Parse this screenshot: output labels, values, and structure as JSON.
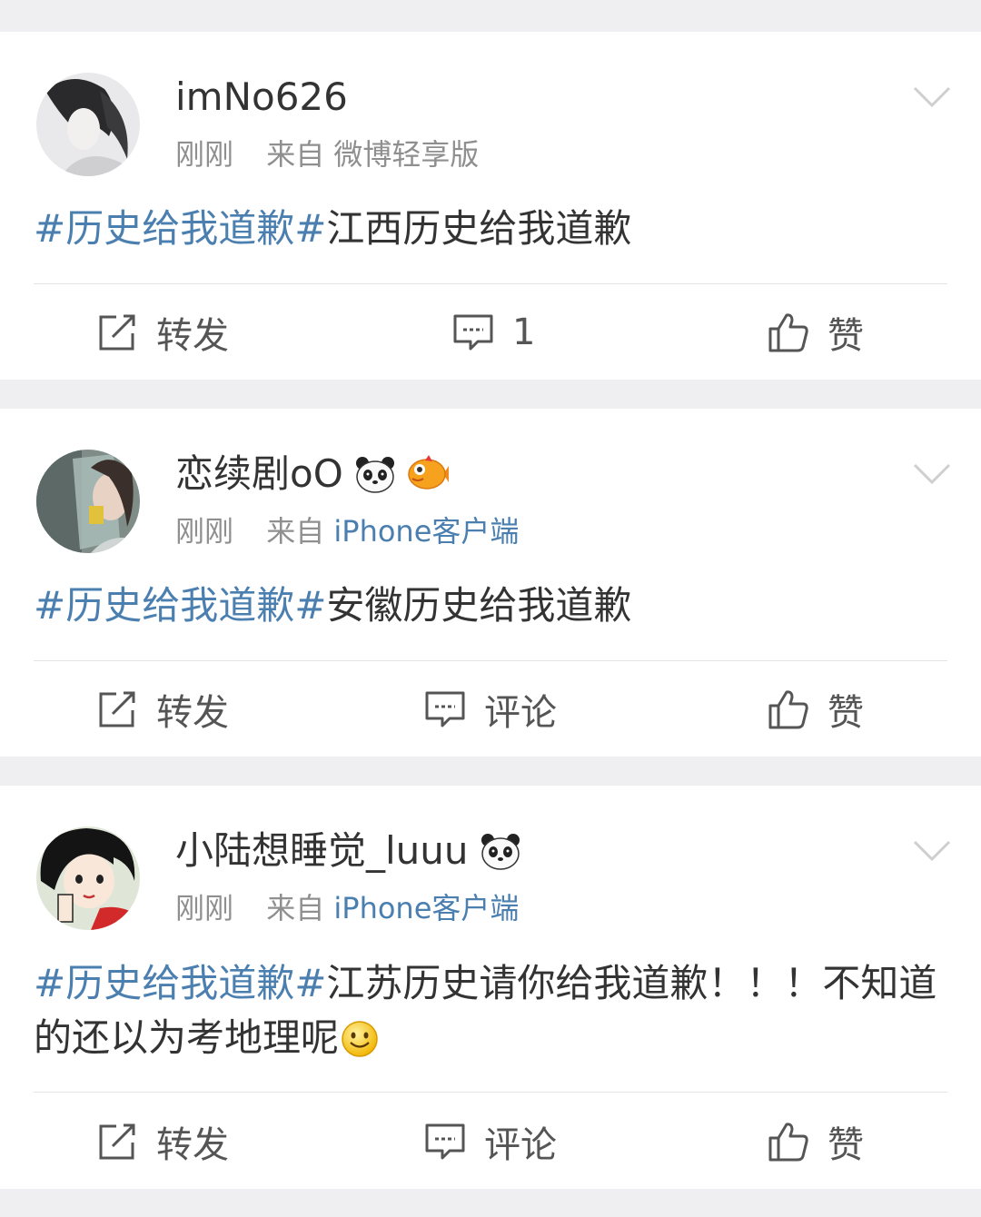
{
  "posts": [
    {
      "username": "imNo626",
      "time": "刚刚",
      "source_prefix": "来自",
      "source": "微博轻享版",
      "hashtag": "#历史给我道歉#",
      "text": "江西历史给我道歉",
      "actions": {
        "repost": "转发",
        "comment": "1",
        "like": "赞"
      },
      "badges": []
    },
    {
      "username": "恋续剧oO",
      "time": "刚刚",
      "source_prefix": "来自",
      "source": "iPhone客户端",
      "hashtag": "#历史给我道歉#",
      "text": "安徽历史给我道歉",
      "actions": {
        "repost": "转发",
        "comment": "评论",
        "like": "赞"
      },
      "badges": [
        "panda-icon",
        "fish-icon"
      ]
    },
    {
      "username": "小陆想睡觉_luuu",
      "time": "刚刚",
      "source_prefix": "来自",
      "source": "iPhone客户端",
      "hashtag": "#历史给我道歉#",
      "text": "江苏历史请你给我道歉！！！不知道的还以为考地理呢",
      "actions": {
        "repost": "转发",
        "comment": "评论",
        "like": "赞"
      },
      "badges": [
        "panda-icon"
      ]
    }
  ],
  "colors": {
    "link": "#4a7fb0",
    "text": "#333333",
    "meta": "#8f8f8f",
    "background": "#efeff1"
  }
}
